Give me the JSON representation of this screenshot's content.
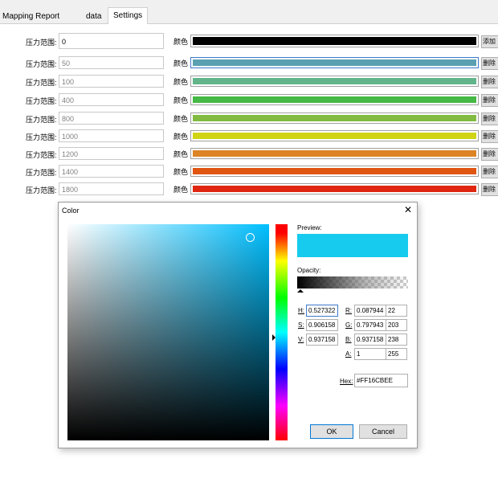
{
  "tabs": [
    {
      "label": "Mapping Report"
    },
    {
      "label": "data"
    },
    {
      "label": "Settings"
    }
  ],
  "rows": [
    {
      "label": "压力范围:",
      "value": "0",
      "color_label": "颜色",
      "color": "#000000",
      "button": "添加"
    },
    {
      "label": "压力范围:",
      "value": "50",
      "color_label": "颜色",
      "color": "#5aa0b0",
      "button": "删除"
    },
    {
      "label": "压力范围:",
      "value": "100",
      "color_label": "颜色",
      "color": "#62b48a",
      "button": "删除"
    },
    {
      "label": "压力范围:",
      "value": "400",
      "color_label": "颜色",
      "color": "#45b845",
      "button": "删除"
    },
    {
      "label": "压力范围:",
      "value": "800",
      "color_label": "颜色",
      "color": "#82bb42",
      "button": "删除"
    },
    {
      "label": "压力范围:",
      "value": "1000",
      "color_label": "颜色",
      "color": "#d0d414",
      "button": "删除"
    },
    {
      "label": "压力范围:",
      "value": "1200",
      "color_label": "颜色",
      "color": "#dc8426",
      "button": "删除"
    },
    {
      "label": "压力范围:",
      "value": "1400",
      "color_label": "颜色",
      "color": "#e05512",
      "button": "删除"
    },
    {
      "label": "压力范围:",
      "value": "1800",
      "color_label": "颜色",
      "color": "#e02610",
      "button": "删除"
    }
  ],
  "dialog": {
    "title": "Color",
    "close": "✕",
    "preview_label": "Preview:",
    "preview_color": "#16cbee",
    "opacity_label": "Opacity:",
    "h_label": "H:",
    "h_value": "0.527322",
    "s_label": "S:",
    "s_value": "0.906158",
    "v_label": "V:",
    "v_value": "0.937158",
    "r_label": "R:",
    "r_value": "0.087944",
    "r_int": "22",
    "g_label": "G:",
    "g_value": "0.797943",
    "g_int": "203",
    "b_label": "B:",
    "b_value": "0.937158",
    "b_int": "238",
    "a_label": "A:",
    "a_value": "1",
    "a_int": "255",
    "hex_label": "Hex:",
    "hex_value": "#FF16CBEE",
    "ok": "OK",
    "cancel": "Cancel"
  }
}
